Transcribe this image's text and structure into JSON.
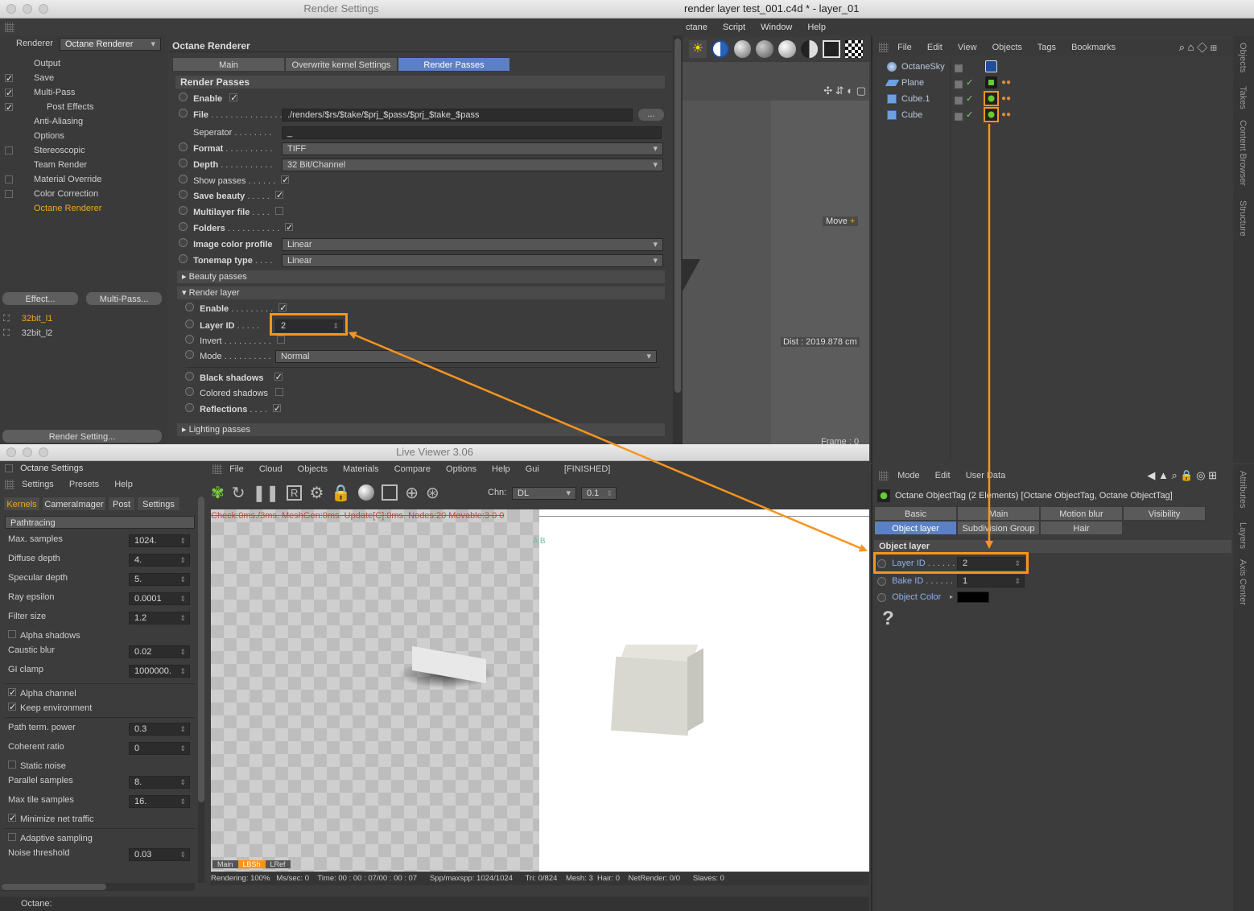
{
  "render_settings": {
    "title": "Render Settings",
    "renderer_label": "Renderer",
    "renderer_value": "Octane Renderer",
    "tree": [
      {
        "label": "Output",
        "check": null
      },
      {
        "label": "Save",
        "check": true
      },
      {
        "label": "Multi-Pass",
        "check": true
      },
      {
        "label": "Post Effects",
        "check": true
      },
      {
        "label": "Anti-Aliasing",
        "check": null
      },
      {
        "label": "Options",
        "check": null
      },
      {
        "label": "Stereoscopic",
        "check": false
      },
      {
        "label": "Team Render",
        "check": null
      },
      {
        "label": "Material Override",
        "check": false
      },
      {
        "label": "Color Correction",
        "check": false
      },
      {
        "label": "Octane Renderer",
        "check": null
      }
    ],
    "effect_button": "Effect...",
    "multipass_button": "Multi-Pass...",
    "takes": [
      "32bit_l1",
      "32bit_l2"
    ],
    "render_setting_button": "Render Setting...",
    "panel_title": "Octane Renderer",
    "tabs": [
      "Main",
      "Overwrite kernel Settings",
      "Render Passes"
    ],
    "section_title": "Render Passes",
    "enable_label": "Enable",
    "file_label": "File",
    "file_value": "./renders/$rs/$take/$prj_$pass/$prj_$take_$pass",
    "file_button": "...",
    "separator_label": "Seperator",
    "separator_value": "_",
    "format_label": "Format",
    "format_value": "TIFF",
    "depth_label": "Depth",
    "depth_value": "32 Bit/Channel",
    "show_passes": "Show passes",
    "save_beauty": "Save beauty",
    "multilayer": "Multilayer file",
    "folders": "Folders",
    "image_color_profile": "Image color profile",
    "image_color_profile_value": "Linear",
    "tonemap_type": "Tonemap type",
    "tonemap_value": "Linear",
    "beauty_passes": "Beauty passes",
    "render_layer": "Render layer",
    "rl_enable": "Enable",
    "layer_id": "Layer ID",
    "layer_id_value": "2",
    "invert": "Invert",
    "mode": "Mode",
    "mode_value": "Normal",
    "black_shadows": "Black shadows",
    "colored_shadows": "Colored shadows",
    "reflections": "Reflections",
    "lighting_passes": "Lighting passes"
  },
  "c4d": {
    "title": "render layer test_001.c4d * - layer_01",
    "menu": [
      "ctane",
      "Script",
      "Window",
      "Help"
    ],
    "viewport_move": "Move",
    "dist": "Dist : 2019.878 cm",
    "frame": "Frame : 0"
  },
  "objects": {
    "menu": [
      "File",
      "Edit",
      "View",
      "Objects",
      "Tags",
      "Bookmarks"
    ],
    "items": [
      "OctaneSky",
      "Plane",
      "Cube.1",
      "Cube"
    ],
    "side_tabs": [
      "Objects",
      "Takes",
      "Content Browser",
      "Structure"
    ]
  },
  "attributes": {
    "menu": [
      "Mode",
      "Edit",
      "User Data"
    ],
    "header": "Octane ObjectTag (2 Elements) [Octane ObjectTag, Octane ObjectTag]",
    "tabs_row1": [
      "Basic",
      "Main",
      "Motion blur",
      "Visibility"
    ],
    "tabs_row2": [
      "Object layer",
      "Subdivision Group",
      "Hair"
    ],
    "section": "Object layer",
    "layer_id_label": "Layer ID",
    "layer_id_value": "2",
    "bake_id_label": "Bake ID",
    "bake_id_value": "1",
    "object_color_label": "Object Color",
    "help_icon": "?",
    "side_tabs": [
      "Attributes",
      "Layers",
      "Axis Center"
    ]
  },
  "live_viewer": {
    "title": "Live Viewer 3.06",
    "octane_settings": "Octane Settings",
    "menu_left": [
      "Settings",
      "Presets",
      "Help"
    ],
    "tabs": [
      "Kernels",
      "CameraImager",
      "Post",
      "Settings"
    ],
    "kernel": "Pathtracing",
    "params": [
      {
        "label": "Max. samples",
        "value": "1024."
      },
      {
        "label": "Diffuse depth",
        "value": "4."
      },
      {
        "label": "Specular depth",
        "value": "5."
      },
      {
        "label": "Ray epsilon",
        "value": "0.0001"
      },
      {
        "label": "Filter size",
        "value": "1.2"
      }
    ],
    "alpha_shadows": "Alpha shadows",
    "caustic_blur": "Caustic blur",
    "caustic_blur_value": "0.02",
    "gi_clamp": "GI clamp",
    "gi_clamp_value": "1000000.",
    "alpha_channel": "Alpha channel",
    "keep_environment": "Keep environment",
    "path_term": "Path term. power",
    "path_term_value": "0.3",
    "coherent_ratio": "Coherent ratio",
    "coherent_ratio_value": "0",
    "static_noise": "Static noise",
    "parallel_samples": "Parallel samples",
    "parallel_samples_value": "8.",
    "max_tile": "Max tile samples",
    "max_tile_value": "16.",
    "minimize_net": "Minimize net traffic",
    "adaptive": "Adaptive sampling",
    "noise_threshold": "Noise threshold",
    "noise_threshold_value": "0.03",
    "menu_right": [
      "File",
      "Cloud",
      "Objects",
      "Materials",
      "Compare",
      "Options",
      "Help",
      "Gui",
      "[FINISHED]"
    ],
    "chn_label": "Chn:",
    "chn_value": "DL",
    "chn_num": "0.1",
    "overlay": "Check:0ms./3ms. MeshGen:0ms. Update[C]:0ms. Nodes:20 Movable:3 0 0",
    "ab": "A  B",
    "bottom_tabs": [
      "Main",
      "LBSh",
      "LRef"
    ],
    "status": "Rendering: 100%   Ms/sec: 0    Time: 00 : 00 : 07/00 : 00 : 07      Spp/maxspp: 1024/1024      Tri: 0/824    Mesh: 3  Hair: 0    NetRender: 0/0      Slaves: 0",
    "footer": "Octane:"
  },
  "colors": {
    "accent": "#f7941d",
    "tab_active": "#5b80c6",
    "panel": "#3c3c3c"
  }
}
